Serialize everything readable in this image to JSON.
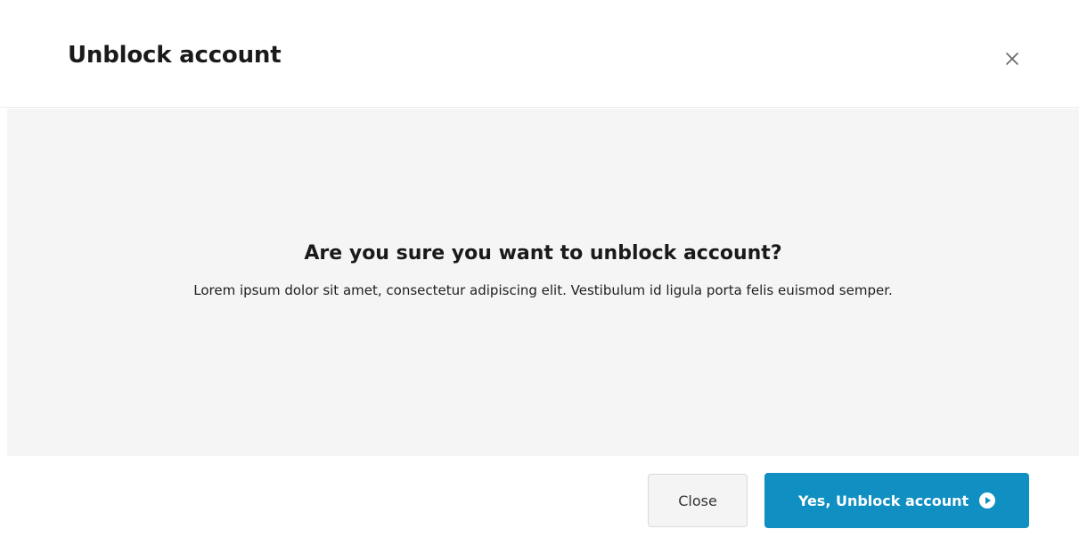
{
  "dialog": {
    "title": "Unblock account",
    "close_icon": "close-icon"
  },
  "body": {
    "question": "Are you sure you want to unblock account?",
    "description": "Lorem ipsum dolor sit amet, consectetur adipiscing elit. Vestibulum id ligula porta felis euismod semper."
  },
  "footer": {
    "close_label": "Close",
    "confirm_label": "Yes, Unblock account",
    "confirm_icon": "play-circle-icon"
  },
  "colors": {
    "primary": "#0f8fc2",
    "body_background": "#f5f5f5",
    "secondary_button": "#f4f4f4"
  }
}
